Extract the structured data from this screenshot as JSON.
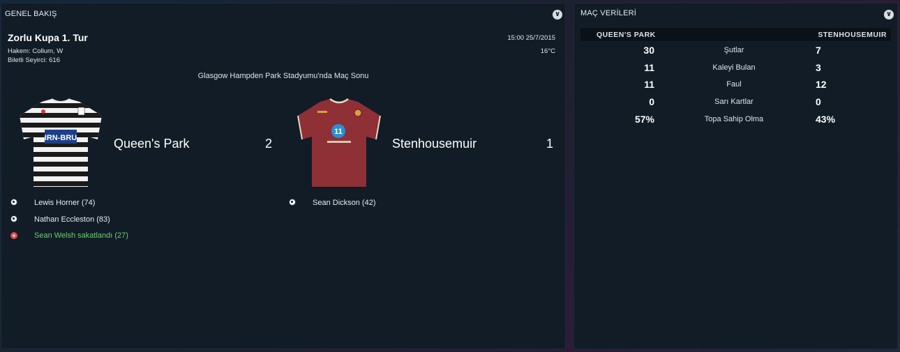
{
  "overview": {
    "title": "GENEL BAKIŞ",
    "competition": "Zorlu Kupa 1. Tur",
    "referee": "Hakem: Collum, W",
    "attendance": "Biletli Seyirci: 616",
    "datetime": "15:00 25/7/2015",
    "temperature": "16°C",
    "venue": "Glasgow Hampden Park Stadyumu'nda Maç Sonu",
    "home": {
      "name": "Queen's Park",
      "score": "2",
      "kit_colors": {
        "stripe_a": "#1a1a1a",
        "stripe_b": "#f2f2f2"
      },
      "sponsor": "IRN-BRU",
      "events": [
        {
          "type": "goal",
          "icon": "ball-icon",
          "text": "Lewis Horner (74)"
        },
        {
          "type": "goal",
          "icon": "ball-icon",
          "text": "Nathan Eccleston (83)"
        },
        {
          "type": "injury",
          "icon": "injury-icon",
          "text": "Sean Welsh sakatlandı (27)"
        }
      ]
    },
    "away": {
      "name": "Stenhousemuir",
      "score": "1",
      "kit_colors": {
        "main": "#8e3036",
        "trim": "#e8d9c8"
      },
      "events": [
        {
          "type": "goal",
          "icon": "ball-icon",
          "text": "Sean Dickson (42)"
        }
      ]
    }
  },
  "match_stats": {
    "title": "MAÇ VERİLERİ",
    "home_label": "QUEEN'S PARK",
    "away_label": "STENHOUSEMUIR",
    "rows": [
      {
        "home": "30",
        "label": "Şutlar",
        "away": "7"
      },
      {
        "home": "11",
        "label": "Kaleyi Bulan",
        "away": "3"
      },
      {
        "home": "11",
        "label": "Faul",
        "away": "12"
      },
      {
        "home": "0",
        "label": "Sarı Kartlar",
        "away": "0"
      },
      {
        "home": "57%",
        "label": "Topa Sahip Olma",
        "away": "43%"
      }
    ]
  },
  "icons": {
    "panel_menu": "chevron-down-icon"
  }
}
